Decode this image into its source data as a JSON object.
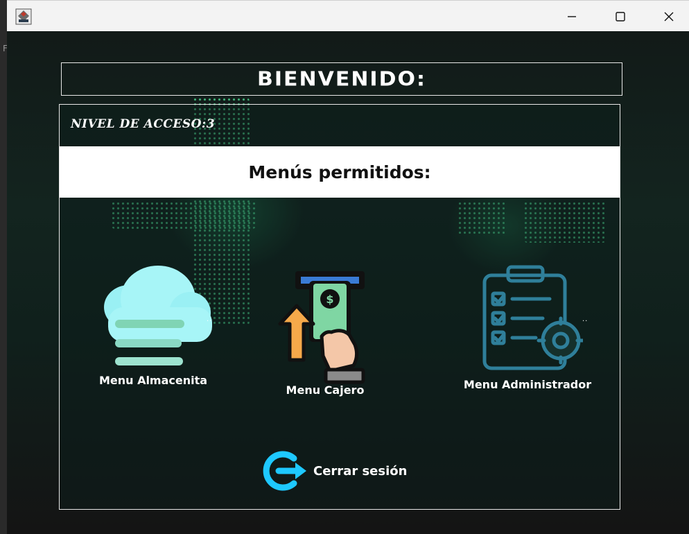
{
  "window": {
    "icon": "java-app-icon",
    "controls": [
      "minimize-icon",
      "maximize-icon",
      "close-icon"
    ],
    "left_edge_fragment": "F"
  },
  "header": {
    "title": "BIENVENIDO:"
  },
  "panel": {
    "access_level": "NIVEL DE ACCESO:3",
    "menus_title": "Menús permitidos:",
    "menus": [
      {
        "label": "Menu Almacenita",
        "icon": "cloud-icon"
      },
      {
        "label": "Menu Cajero",
        "icon": "atm-cash-icon"
      },
      {
        "label": "Menu Administrador",
        "icon": "clipboard-gear-icon"
      }
    ],
    "trailing_marks": "..",
    "logout": {
      "label": "Cerrar sesión",
      "icon": "logout-icon"
    }
  },
  "colors": {
    "accent_green": "#3cf0a0",
    "cloud": "#9af0f4",
    "admin_icon": "#2f7f9a",
    "logout_icon": "#1ec8ff"
  }
}
